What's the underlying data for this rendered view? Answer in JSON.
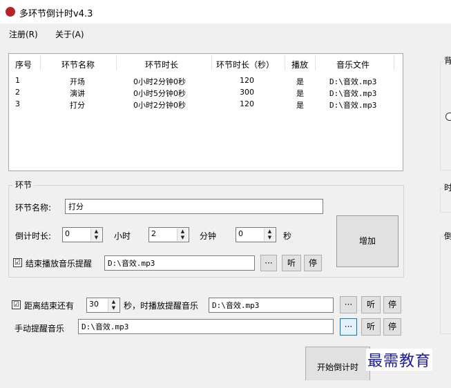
{
  "window": {
    "title": "多环节倒计时v4.3"
  },
  "menu": {
    "register": "注册(R)",
    "about": "关于(A)"
  },
  "table": {
    "columns": [
      "序号",
      "环节名称",
      "环节时长",
      "环节时长（秒）",
      "播放",
      "音乐文件"
    ],
    "rows": [
      [
        "1",
        "开场",
        "0小时2分钟0秒",
        "120",
        "是",
        "D:\\音效.mp3"
      ],
      [
        "2",
        "演讲",
        "0小时5分钟0秒",
        "300",
        "是",
        "D:\\音效.mp3"
      ],
      [
        "3",
        "打分",
        "0小时2分钟0秒",
        "120",
        "是",
        "D:\\音效.mp3"
      ]
    ]
  },
  "segment": {
    "group_title": "环节",
    "name_label": "环节名称:",
    "name_value": "打分",
    "duration_label": "倒计时长:",
    "hours_value": "0",
    "hours_label": "小时",
    "minutes_value": "2",
    "minutes_label": "分钟",
    "seconds_value": "0",
    "seconds_label": "秒",
    "add_button": "增加",
    "end_music_checked": "☑",
    "end_music_label": "结束播放音乐提醒",
    "end_music_path": "D:\\音效.mp3",
    "browse": "···",
    "listen": "听",
    "stop": "停"
  },
  "reminder": {
    "checked": "☑",
    "prefix_label": "距离结束还有",
    "seconds_value": "30",
    "suffix_label": "秒，时播放提醒音乐",
    "path": "D:\\音效.mp3",
    "browse": "···",
    "listen": "听",
    "stop": "停"
  },
  "manual": {
    "label": "手动提醒音乐",
    "path": "D:\\音效.mp3",
    "browse": "···",
    "listen": "听",
    "stop": "停"
  },
  "start_button": "开始倒计时",
  "watermark": "最需教育",
  "right_panel": {
    "label1": "背",
    "label2": "时",
    "label3": "倒"
  }
}
